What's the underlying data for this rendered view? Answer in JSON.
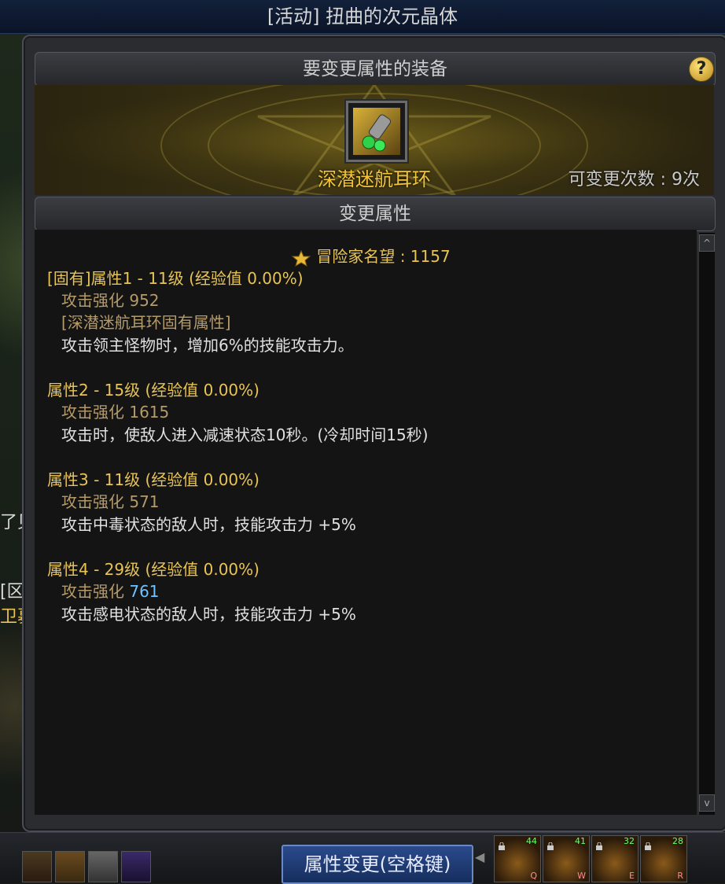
{
  "window": {
    "title": "[活动] 扭曲的次元晶体"
  },
  "equip_section": {
    "header": "要变更属性的装备",
    "help_glyph": "?",
    "item_name": "深潜迷航耳环",
    "change_count": "可变更次数 : 9次"
  },
  "attr_section": {
    "header": "变更属性",
    "reputation_label": "冒险家名望 : 1157",
    "attributes": [
      {
        "head": "[固有]属性1 - 11级 (经验值 0.00%)",
        "stat_label": "攻击强化",
        "stat_value": "952",
        "tag": "[深潜迷航耳环固有属性]",
        "desc": "攻击领主怪物时，增加6%的技能攻击力。"
      },
      {
        "head": "属性2 - 15级 (经验值 0.00%)",
        "stat_label": "攻击强化",
        "stat_value": "1615",
        "desc": "攻击时，使敌人进入减速状态10秒。(冷却时间15秒)"
      },
      {
        "head": "属性3 - 11级 (经验值 0.00%)",
        "stat_label": "攻击强化",
        "stat_value": "571",
        "desc": "攻击中毒状态的敌人时，技能攻击力 +5%"
      },
      {
        "head": "属性4 - 29级 (经验值 0.00%)",
        "stat_label": "攻击强化",
        "stat_value": "761",
        "desc": "攻击感电状态的敌人时，技能攻击力 +5%"
      }
    ]
  },
  "confirm_button": {
    "label": "属性变更(空格键)"
  },
  "skills": [
    {
      "level": "44",
      "key": "Q"
    },
    {
      "level": "41",
      "key": "W"
    },
    {
      "level": "32",
      "key": "E"
    },
    {
      "level": "28",
      "key": "R"
    }
  ],
  "left_fragments": [
    "了见",
    "[区",
    "卫募"
  ],
  "colors": {
    "gold_text": "#e8c457",
    "item_name": "#f2c43b",
    "stat_brown": "#b59a6a",
    "blue_value": "#6fc3ff",
    "button_blue": "#2a4a8c"
  }
}
